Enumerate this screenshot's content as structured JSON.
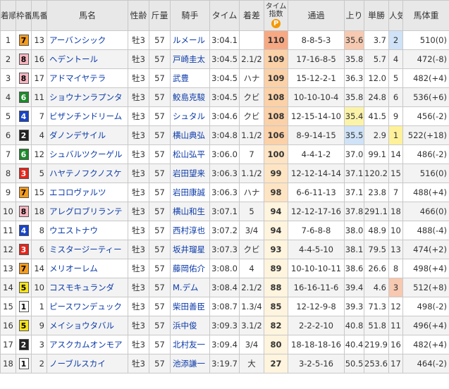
{
  "headers": {
    "rank": "着順",
    "waku": "枠番",
    "umaban": "馬番",
    "name": "馬名",
    "sexage": "性齢",
    "weight": "斤量",
    "jockey": "騎手",
    "time": "タイム",
    "margin": "着差",
    "index": "タイム指数",
    "index_mark": "P",
    "passing": "通過",
    "last3f": "上り",
    "odds": "単勝",
    "popularity": "人気",
    "body_weight": "馬体重"
  },
  "rows": [
    {
      "rank": "1",
      "waku": "7",
      "umaban": "13",
      "name": "アーバンシック",
      "sexage": "牡3",
      "weight": "57",
      "jockey": "ルメール",
      "time": "3:04.1",
      "margin": "",
      "index": "110",
      "passing": "8-8-5-3",
      "last3f": "35.6",
      "odds": "3.7",
      "pop": "2",
      "body": "510(0)"
    },
    {
      "rank": "2",
      "waku": "8",
      "umaban": "16",
      "name": "ヘデントール",
      "sexage": "牡3",
      "weight": "57",
      "jockey": "戸崎圭太",
      "time": "3:04.5",
      "margin": "2.1/2",
      "index": "109",
      "passing": "17-16-8-5",
      "last3f": "35.8",
      "odds": "5.7",
      "pop": "4",
      "body": "472(-8)"
    },
    {
      "rank": "3",
      "waku": "8",
      "umaban": "17",
      "name": "アドマイヤテラ",
      "sexage": "牡3",
      "weight": "57",
      "jockey": "武豊",
      "time": "3:04.5",
      "margin": "ハナ",
      "index": "109",
      "passing": "15-12-2-1",
      "last3f": "36.3",
      "odds": "12.0",
      "pop": "5",
      "body": "482(+4)"
    },
    {
      "rank": "4",
      "waku": "6",
      "umaban": "11",
      "name": "ショウナンラプンタ",
      "sexage": "牡3",
      "weight": "57",
      "jockey": "鮫島克駿",
      "time": "3:04.5",
      "margin": "クビ",
      "index": "108",
      "passing": "10-10-10-4",
      "last3f": "35.8",
      "odds": "24.8",
      "pop": "6",
      "body": "536(+6)"
    },
    {
      "rank": "5",
      "waku": "4",
      "umaban": "7",
      "name": "ビザンチンドリーム",
      "sexage": "牡3",
      "weight": "57",
      "jockey": "シュタル",
      "time": "3:04.6",
      "margin": "クビ",
      "index": "108",
      "passing": "12-15-14-10",
      "last3f": "35.4",
      "odds": "41.5",
      "pop": "9",
      "body": "456(-2)"
    },
    {
      "rank": "6",
      "waku": "2",
      "umaban": "4",
      "name": "ダノンデサイル",
      "sexage": "牡3",
      "weight": "57",
      "jockey": "横山典弘",
      "time": "3:04.8",
      "margin": "1.1/2",
      "index": "106",
      "passing": "8-9-14-15",
      "last3f": "35.5",
      "odds": "2.9",
      "pop": "1",
      "body": "522(+18)"
    },
    {
      "rank": "7",
      "waku": "6",
      "umaban": "12",
      "name": "シュバルツクーゲル",
      "sexage": "牡3",
      "weight": "57",
      "jockey": "松山弘平",
      "time": "3:06.0",
      "margin": "7",
      "index": "100",
      "passing": "4-4-1-2",
      "last3f": "37.0",
      "odds": "99.1",
      "pop": "14",
      "body": "486(-2)"
    },
    {
      "rank": "8",
      "waku": "3",
      "umaban": "5",
      "name": "ハヤテノフクノスケ",
      "sexage": "牡3",
      "weight": "57",
      "jockey": "岩田望来",
      "time": "3:06.3",
      "margin": "1.1/2",
      "index": "99",
      "passing": "12-12-14-14",
      "last3f": "37.1",
      "odds": "120.2",
      "pop": "15",
      "body": "516(0)"
    },
    {
      "rank": "9",
      "waku": "7",
      "umaban": "15",
      "name": "エコロヴァルツ",
      "sexage": "牡3",
      "weight": "57",
      "jockey": "岩田康誠",
      "time": "3:06.3",
      "margin": "ハナ",
      "index": "98",
      "passing": "6-6-11-13",
      "last3f": "37.1",
      "odds": "23.8",
      "pop": "7",
      "body": "488(+4)"
    },
    {
      "rank": "10",
      "waku": "8",
      "umaban": "18",
      "name": "アレグロブリランテ",
      "sexage": "牡3",
      "weight": "57",
      "jockey": "横山和生",
      "time": "3:07.1",
      "margin": "5",
      "index": "94",
      "passing": "12-12-17-16",
      "last3f": "37.8",
      "odds": "291.1",
      "pop": "18",
      "body": "466(0)"
    },
    {
      "rank": "11",
      "waku": "4",
      "umaban": "8",
      "name": "ウエストナウ",
      "sexage": "牡3",
      "weight": "57",
      "jockey": "西村淳也",
      "time": "3:07.2",
      "margin": "3/4",
      "index": "94",
      "passing": "7-6-8-8",
      "last3f": "38.0",
      "odds": "48.9",
      "pop": "10",
      "body": "488(-4)"
    },
    {
      "rank": "12",
      "waku": "3",
      "umaban": "6",
      "name": "ミスタージーティー",
      "sexage": "牡3",
      "weight": "57",
      "jockey": "坂井瑠星",
      "time": "3:07.3",
      "margin": "クビ",
      "index": "93",
      "passing": "4-4-5-10",
      "last3f": "38.1",
      "odds": "79.5",
      "pop": "13",
      "body": "474(+2)"
    },
    {
      "rank": "13",
      "waku": "7",
      "umaban": "14",
      "name": "メリオーレム",
      "sexage": "牡3",
      "weight": "57",
      "jockey": "藤岡佑介",
      "time": "3:08.0",
      "margin": "4",
      "index": "89",
      "passing": "10-10-10-11",
      "last3f": "38.6",
      "odds": "26.6",
      "pop": "8",
      "body": "498(+4)"
    },
    {
      "rank": "14",
      "waku": "5",
      "umaban": "10",
      "name": "コスモキュランダ",
      "sexage": "牡3",
      "weight": "57",
      "jockey": "M.デム",
      "time": "3:08.4",
      "margin": "2.1/2",
      "index": "88",
      "passing": "16-16-11-6",
      "last3f": "39.4",
      "odds": "4.6",
      "pop": "3",
      "body": "512(+8)"
    },
    {
      "rank": "15",
      "waku": "1",
      "umaban": "1",
      "name": "ピースワンデュック",
      "sexage": "牡3",
      "weight": "57",
      "jockey": "柴田善臣",
      "time": "3:08.7",
      "margin": "1.3/4",
      "index": "85",
      "passing": "12-12-9-8",
      "last3f": "39.3",
      "odds": "71.3",
      "pop": "12",
      "body": "498(-2)"
    },
    {
      "rank": "16",
      "waku": "5",
      "umaban": "9",
      "name": "メイショウタバル",
      "sexage": "牡3",
      "weight": "57",
      "jockey": "浜中俊",
      "time": "3:09.3",
      "margin": "3.1/2",
      "index": "82",
      "passing": "2-2-2-10",
      "last3f": "40.8",
      "odds": "51.8",
      "pop": "11",
      "body": "496(+4)"
    },
    {
      "rank": "17",
      "waku": "2",
      "umaban": "3",
      "name": "アスクカムオンモア",
      "sexage": "牡3",
      "weight": "57",
      "jockey": "北村友一",
      "time": "3:09.4",
      "margin": "3/4",
      "index": "80",
      "passing": "18-18-18-16",
      "last3f": "40.4",
      "odds": "219.9",
      "pop": "16",
      "body": "482(+4)"
    },
    {
      "rank": "18",
      "waku": "1",
      "umaban": "2",
      "name": "ノーブルスカイ",
      "sexage": "牡3",
      "weight": "57",
      "jockey": "池添謙一",
      "time": "3:19.7",
      "margin": "大",
      "index": "27",
      "passing": "3-2-5-16",
      "last3f": "50.5",
      "odds": "253.6",
      "pop": "17",
      "body": "464(-2)"
    }
  ],
  "waku_colors": {
    "1": {
      "bg": "#ffffff",
      "fg": "#000000"
    },
    "2": {
      "bg": "#222222",
      "fg": "#ffffff"
    },
    "3": {
      "bg": "#e3261c",
      "fg": "#ffffff"
    },
    "4": {
      "bg": "#1745c8",
      "fg": "#ffffff"
    },
    "5": {
      "bg": "#f7e31a",
      "fg": "#000000"
    },
    "6": {
      "bg": "#1d8a2a",
      "fg": "#ffffff"
    },
    "7": {
      "bg": "#f39b1e",
      "fg": "#000000"
    },
    "8": {
      "bg": "#f7b5c0",
      "fg": "#000000"
    }
  },
  "highlights": {
    "last3f_rank": {
      "35.4": "up2",
      "35.5": "up3",
      "35.6": "up1"
    },
    "pop_rank": {
      "1": "pop1",
      "2": "pop2",
      "3": "pop3"
    }
  }
}
